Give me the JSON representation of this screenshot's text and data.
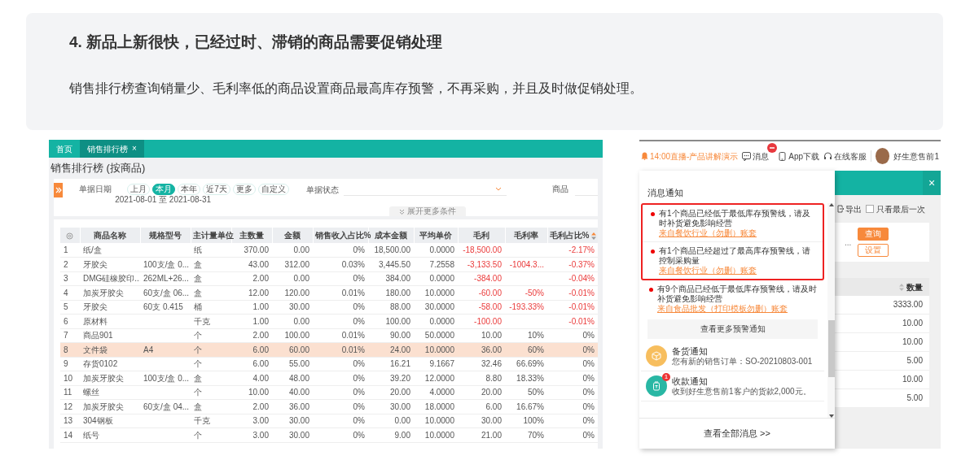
{
  "intro": {
    "heading": "4. 新品上新很快，已经过时、滞销的商品需要促销处理",
    "description": "销售排行榜查询销量少、毛利率低的商品设置商品最高库存预警，不再采购，并且及时做促销处理。"
  },
  "sales_screen": {
    "tabs": [
      {
        "label": "首页",
        "selected": false
      },
      {
        "label": "销售排行榜",
        "selected": true,
        "close": "×"
      }
    ],
    "page_title": "销售排行榜 (按商品)",
    "filters": {
      "date_label": "单据日期",
      "date_options": [
        {
          "label": "上月",
          "selected": false
        },
        {
          "label": "本月",
          "selected": true
        },
        {
          "label": "本年",
          "selected": false
        },
        {
          "label": "近7天",
          "selected": false
        },
        {
          "label": "更多",
          "selected": false
        },
        {
          "label": "自定义",
          "selected": false
        }
      ],
      "date_range": "2021-08-01 至 2021-08-31",
      "status_label": "单据状态",
      "product_label": "商品",
      "expand": "展开更多条件"
    },
    "table": {
      "columns": [
        "",
        "商品名称",
        "规格型号",
        "主计量单位",
        "主数量",
        "金额",
        "销售收入占比%",
        "成本金额",
        "平均单价",
        "毛利",
        "毛利率",
        "毛利占比%"
      ],
      "rows": [
        {
          "cells": [
            "1",
            "纸/盒",
            null,
            "纸",
            "370.00",
            "0.00",
            "0%",
            "18,500.00",
            "0.0000",
            "-18,500.00",
            null,
            "-2.17%"
          ],
          "selected": false,
          "negative": true
        },
        {
          "cells": [
            "2",
            "牙胶尖",
            "100支/盒 0...",
            "盒",
            "43.00",
            "312.00",
            "0.03%",
            "3,445.50",
            "7.2558",
            "-3,133.50",
            "-1004.3...",
            "-0.37%"
          ],
          "selected": false,
          "negative": true
        },
        {
          "cells": [
            "3",
            "DMG硅橡胶印...",
            "262ML+26...",
            "盒",
            "2.00",
            "0.00",
            "0%",
            "384.00",
            "0.0000",
            "-384.00",
            null,
            "-0.04%"
          ],
          "selected": false,
          "negative": true
        },
        {
          "cells": [
            "4",
            "加炭牙胶尖",
            "60支/盒 06...",
            "盒",
            "12.00",
            "120.00",
            "0.01%",
            "180.00",
            "10.0000",
            "-60.00",
            "-50%",
            "-0.01%"
          ],
          "selected": false,
          "negative": true
        },
        {
          "cells": [
            "5",
            "牙胶尖",
            "60支 0.415",
            "桶",
            "1.00",
            "30.00",
            "0%",
            "88.00",
            "30.0000",
            "-58.00",
            "-193.33%",
            "-0.01%"
          ],
          "selected": false,
          "negative": true
        },
        {
          "cells": [
            "6",
            "原材料",
            null,
            "千克",
            "1.00",
            "0.00",
            "0%",
            "100.00",
            "0.0000",
            "-100.00",
            null,
            "-0.01%"
          ],
          "selected": false,
          "negative": true
        },
        {
          "cells": [
            "7",
            "商品901",
            null,
            "个",
            "2.00",
            "100.00",
            "0.01%",
            "90.00",
            "50.0000",
            "10.00",
            "10%",
            "0%"
          ],
          "selected": false,
          "negative": false
        },
        {
          "cells": [
            "8",
            "文件袋",
            "A4",
            "个",
            "6.00",
            "60.00",
            "0.01%",
            "24.00",
            "10.0000",
            "36.00",
            "60%",
            "0%"
          ],
          "selected": true,
          "negative": false
        },
        {
          "cells": [
            "9",
            "存货0102",
            null,
            "个",
            "6.00",
            "55.00",
            "0%",
            "16.21",
            "9.1667",
            "32.46",
            "66.69%",
            "0%"
          ],
          "selected": false,
          "negative": false
        },
        {
          "cells": [
            "10",
            "加炭牙胶尖",
            "100支/盒 0...",
            "盒",
            "4.00",
            "48.00",
            "0%",
            "39.20",
            "12.0000",
            "8.80",
            "18.33%",
            "0%"
          ],
          "selected": false,
          "negative": false
        },
        {
          "cells": [
            "11",
            "螺丝",
            null,
            "个",
            "10.00",
            "40.00",
            "0%",
            "20.00",
            "4.0000",
            "20.00",
            "50%",
            "0%"
          ],
          "selected": false,
          "negative": false
        },
        {
          "cells": [
            "12",
            "加炭牙胶尖",
            "60支/盒 04...",
            "盒",
            "2.00",
            "36.00",
            "0%",
            "30.00",
            "18.0000",
            "6.00",
            "16.67%",
            "0%"
          ],
          "selected": false,
          "negative": false
        },
        {
          "cells": [
            "13",
            "304钢板",
            null,
            "千克",
            "3.00",
            "30.00",
            "0%",
            "0.00",
            "10.0000",
            "30.00",
            "100%",
            "0%"
          ],
          "selected": false,
          "negative": false
        },
        {
          "cells": [
            "14",
            "纸号",
            null,
            "个",
            "3.00",
            "30.00",
            "0%",
            "9.00",
            "10.0000",
            "21.00",
            "70%",
            "0%"
          ],
          "selected": false,
          "negative": false
        }
      ]
    }
  },
  "message_screen": {
    "top_bar": {
      "live": "14:00直播-产品讲解演示",
      "links": [
        {
          "kind": "message",
          "label": "消息"
        },
        {
          "kind": "app",
          "label": "App下载"
        },
        {
          "kind": "service",
          "label": "在线客服"
        }
      ],
      "user": "好生意售前1"
    },
    "notifications": {
      "title": "消息通知",
      "alerts": [
        {
          "text": "有1个商品已经低于最低库存预警线，请及时补货避免影响经营",
          "source": "来自餐饮行业（勿删）账套",
          "highlighted": true
        },
        {
          "text": "有1个商品已经超过了最高库存预警线，请控制采购量",
          "source": "来自餐饮行业（勿删）账套",
          "highlighted": true
        },
        {
          "text": "有9个商品已经低于最低库存预警线，请及时补货避免影响经营",
          "source": "来自食品批发（打印模板勿删）账套",
          "highlighted": false
        }
      ],
      "more": "查看更多预警通知",
      "messages": [
        {
          "kind": "stock",
          "title": "备货通知",
          "text": "您有新的销售订单：SO-20210803-001"
        },
        {
          "kind": "payment",
          "title": "收款通知",
          "text": "收到好生意售前1客户的货款2,000元。",
          "badge": "1"
        }
      ],
      "footer": "查看全部消息 >>"
    },
    "background": {
      "close": "×",
      "export": "导出",
      "last_only": {
        "label": "只看最后一次",
        "checked": false
      },
      "ellipsis": "...",
      "query": "查询",
      "settings": "设置",
      "column": "数量",
      "values": [
        "3333.00",
        "10.00",
        "10.00",
        "5.00",
        "10.00",
        "5.00"
      ]
    }
  }
}
